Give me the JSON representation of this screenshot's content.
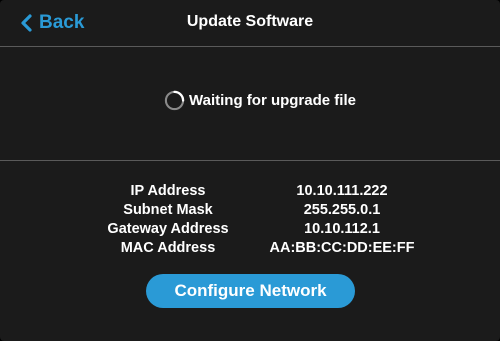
{
  "header": {
    "back_label": "Back",
    "title": "Update Software"
  },
  "status": {
    "icon": "spinner-icon",
    "text": "Waiting for upgrade file"
  },
  "network": {
    "rows": [
      {
        "label": "IP Address",
        "value": "10.10.111.222"
      },
      {
        "label": "Subnet Mask",
        "value": "255.255.0.1"
      },
      {
        "label": "Gateway Address",
        "value": "10.10.112.1"
      },
      {
        "label": "MAC Address",
        "value": "AA:BB:CC:DD:EE:FF"
      }
    ]
  },
  "actions": {
    "configure_label": "Configure Network"
  },
  "colors": {
    "accent": "#2a9ad6",
    "background": "#1b1b1b",
    "text": "#ffffff",
    "divider": "#5a5a5a"
  }
}
